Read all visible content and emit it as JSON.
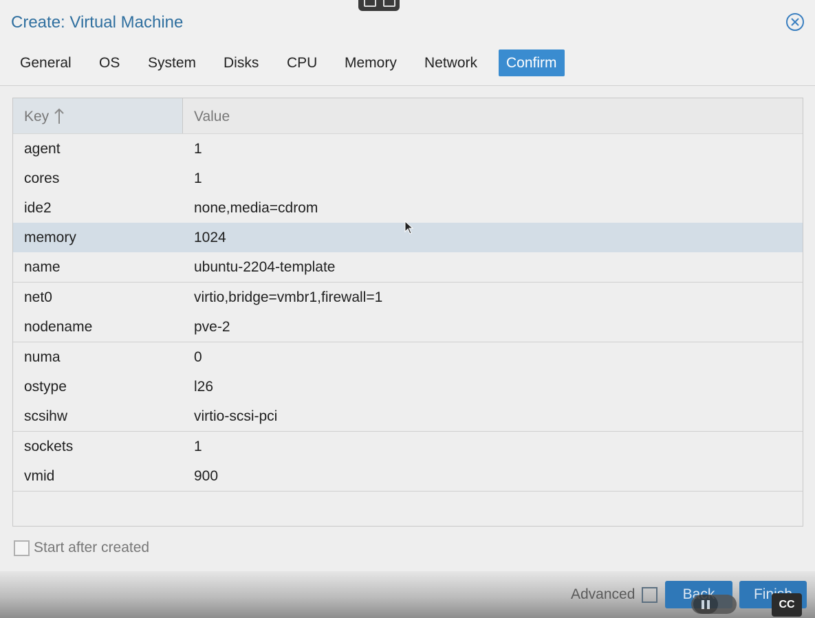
{
  "dialog": {
    "title": "Create: Virtual Machine"
  },
  "tabs": [
    {
      "label": "General"
    },
    {
      "label": "OS"
    },
    {
      "label": "System"
    },
    {
      "label": "Disks"
    },
    {
      "label": "CPU"
    },
    {
      "label": "Memory"
    },
    {
      "label": "Network"
    },
    {
      "label": "Confirm",
      "active": true
    }
  ],
  "grid": {
    "columns": {
      "key": "Key",
      "value": "Value"
    },
    "sort": "ascending",
    "selected_row": "memory",
    "rows": [
      {
        "key": "agent",
        "value": "1"
      },
      {
        "key": "cores",
        "value": "1"
      },
      {
        "key": "ide2",
        "value": "none,media=cdrom"
      },
      {
        "key": "memory",
        "value": "1024"
      },
      {
        "key": "name",
        "value": "ubuntu-2204-template"
      },
      {
        "key": "net0",
        "value": "virtio,bridge=vmbr1,firewall=1"
      },
      {
        "key": "nodename",
        "value": "pve-2"
      },
      {
        "key": "numa",
        "value": "0"
      },
      {
        "key": "ostype",
        "value": "l26"
      },
      {
        "key": "scsihw",
        "value": "virtio-scsi-pci"
      },
      {
        "key": "sockets",
        "value": "1"
      },
      {
        "key": "vmid",
        "value": "900"
      }
    ]
  },
  "options": {
    "start_after_created": {
      "label": "Start after created",
      "checked": false
    }
  },
  "footer": {
    "advanced_label": "Advanced",
    "advanced_checked": false,
    "back_label": "Back",
    "finish_label": "Finish"
  },
  "overlay": {
    "cc_label": "CC"
  },
  "colors": {
    "accent": "#3a8cd0",
    "title": "#2f6f9f",
    "selected_row": "#d3dde6",
    "button": "#2f78b8"
  }
}
